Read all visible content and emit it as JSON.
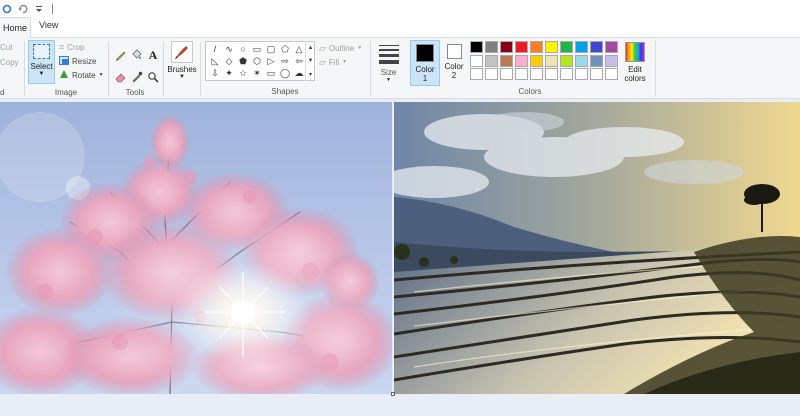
{
  "window": {
    "quick_access": [
      "redo-icon",
      "undo-icon",
      "customize-dropdown-icon"
    ]
  },
  "tabs": [
    {
      "label": "Home",
      "active": true
    },
    {
      "label": "View",
      "active": false
    }
  ],
  "clipboard": {
    "cut_label": "Cut",
    "copy_label": "Copy",
    "group_label": "d"
  },
  "image_group": {
    "select_label": "Select",
    "crop_label": "Crop",
    "resize_label": "Resize",
    "rotate_label": "Rotate",
    "group_label": "Image"
  },
  "tools_group": {
    "items": [
      "pencil-icon",
      "fill-icon",
      "text-icon",
      "eraser-icon",
      "color-picker-icon",
      "magnifier-icon"
    ],
    "group_label": "Tools"
  },
  "brushes": {
    "label": "Brushes"
  },
  "shapes_group": {
    "shapes": [
      "/",
      "∿",
      "○",
      "▭",
      "▢",
      "⬠",
      "△",
      "◺",
      "◇",
      "⬟",
      "⬡",
      "▷",
      "⇨",
      "⇦",
      "⇩",
      "✦",
      "☆",
      "✶",
      "▭",
      "◯",
      "☁"
    ],
    "outline_label": "Outline",
    "fill_label": "Fill",
    "group_label": "Shapes"
  },
  "size": {
    "label": "Size"
  },
  "colors_group": {
    "color1_label_line1": "Color",
    "color1_label_line2": "1",
    "color1_value": "#000000",
    "color2_label_line1": "Color",
    "color2_label_line2": "2",
    "color2_value": "#ffffff",
    "edit_label_line1": "Edit",
    "edit_label_line2": "colors",
    "group_label": "Colors",
    "palette": [
      "#000000",
      "#7f7f7f",
      "#880015",
      "#ed1c24",
      "#ff7f27",
      "#fff200",
      "#22b14c",
      "#00a2e8",
      "#3f48cc",
      "#a349a4",
      "#ffffff",
      "#c3c3c3",
      "#b97a57",
      "#ffaec9",
      "#ffc90e",
      "#efe4b0",
      "#b5e61d",
      "#99d9ea",
      "#7092be",
      "#c8bfe7",
      "#ffffff",
      "#ffffff",
      "#ffffff",
      "#ffffff",
      "#ffffff",
      "#ffffff",
      "#ffffff",
      "#ffffff",
      "#ffffff",
      "#ffffff"
    ]
  },
  "canvas": {
    "left_image": "cherry-blossom-photo",
    "right_image": "rice-terraces-sunset-photo"
  }
}
